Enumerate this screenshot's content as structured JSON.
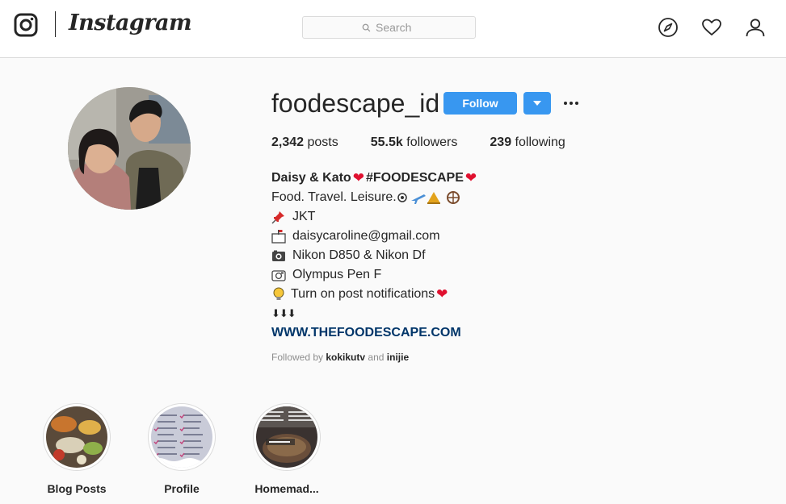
{
  "nav": {
    "wordmark": "Instagram",
    "search_placeholder": "Search"
  },
  "profile": {
    "username": "foodescape_id",
    "follow_label": "Follow",
    "stats": {
      "posts_count": "2,342",
      "posts_label": "posts",
      "followers_count": "55.5k",
      "followers_label": "followers",
      "following_count": "239",
      "following_label": "following"
    },
    "bio": {
      "name": "Daisy & Kato",
      "name_tag": "#FOODESCAPE",
      "tagline": "Food. Travel. Leisure.",
      "location": "JKT",
      "email": "daisycaroline@gmail.com",
      "camera1": "Nikon D850 & Nikon Df",
      "camera2": "Olympus Pen F",
      "notifications": "Turn on post notifications",
      "arrows": "⬇⬇⬇",
      "website": "WWW.THEFOODESCAPE.COM"
    },
    "followed_by": {
      "prefix": "Followed by",
      "user1": "kokikutv",
      "conjunction": "and",
      "user2": "inijie"
    }
  },
  "highlights": [
    {
      "label": "Blog Posts"
    },
    {
      "label": "Profile"
    },
    {
      "label": "Homemad..."
    }
  ],
  "colors": {
    "accent": "#3897f0",
    "link": "#003569",
    "heart": "#e0102f"
  }
}
